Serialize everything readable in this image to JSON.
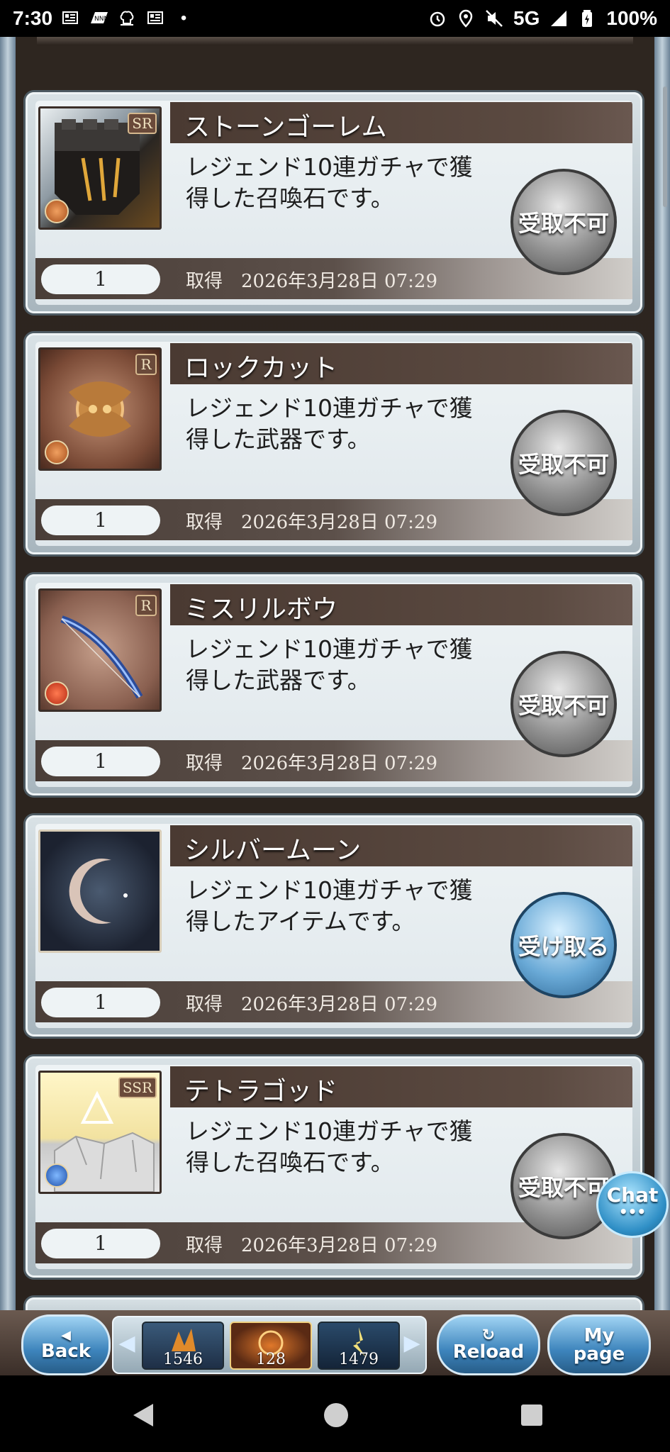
{
  "status_bar": {
    "time": "7:30",
    "network": "5G",
    "battery": "100%",
    "icons": [
      "newspaper-icon",
      "nnn-app-icon",
      "chef-icon",
      "newspaper-icon",
      "dot-icon",
      "alarm-icon",
      "location-icon",
      "mute-icon",
      "signal-icon",
      "battery-icon"
    ]
  },
  "items": [
    {
      "name": "ストーンゴーレム",
      "desc_line1": "レジェンド10連ガチャで獲",
      "desc_line2": "得した召喚石です。",
      "quantity": "1",
      "acq_label": "取得",
      "acq_date": "2026年3月28日 07:29",
      "rarity": "SR",
      "element": "earth",
      "button": "受取不可",
      "button_state": "disabled"
    },
    {
      "name": "ロックカット",
      "desc_line1": "レジェンド10連ガチャで獲",
      "desc_line2": "得した武器です。",
      "quantity": "1",
      "acq_label": "取得",
      "acq_date": "2026年3月28日 07:29",
      "rarity": "R",
      "element": "earth",
      "button": "受取不可",
      "button_state": "disabled"
    },
    {
      "name": "ミスリルボウ",
      "desc_line1": "レジェンド10連ガチャで獲",
      "desc_line2": "得した武器です。",
      "quantity": "1",
      "acq_label": "取得",
      "acq_date": "2026年3月28日 07:29",
      "rarity": "R",
      "element": "fire",
      "button": "受取不可",
      "button_state": "disabled"
    },
    {
      "name": "シルバームーン",
      "desc_line1": "レジェンド10連ガチャで獲",
      "desc_line2": "得したアイテムです。",
      "quantity": "1",
      "acq_label": "取得",
      "acq_date": "2026年3月28日 07:29",
      "rarity": "",
      "element": "",
      "button": "受け取る",
      "button_state": "enabled"
    },
    {
      "name": "テトラゴッド",
      "desc_line1": "レジェンド10連ガチャで獲",
      "desc_line2": "得した召喚石です。",
      "quantity": "1",
      "acq_label": "取得",
      "acq_date": "2026年3月28日 07:29",
      "rarity": "SSR",
      "element": "water",
      "button": "受取不可",
      "button_state": "disabled"
    }
  ],
  "chat": {
    "label": "Chat",
    "dots": "•••"
  },
  "toolbar": {
    "back": "Back",
    "reload": "Reload",
    "mypage_line1": "My",
    "mypage_line2": "page",
    "slots": [
      "1546",
      "128",
      "1479"
    ]
  },
  "colors": {
    "disabled_button": "#8f8f8f",
    "enabled_button": "#69a9d6",
    "title_bar": "#4a3a32"
  }
}
